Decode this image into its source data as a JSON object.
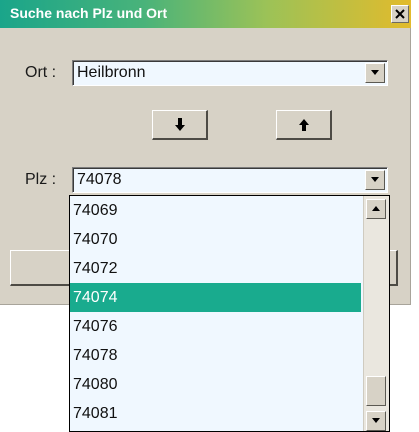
{
  "window": {
    "title": "Suche nach Plz und Ort"
  },
  "ort": {
    "label": "Ort :",
    "value": "Heilbronn"
  },
  "plz": {
    "label": "Plz :",
    "value": "74078"
  },
  "buttons": {
    "down_icon": "arrow-down-icon",
    "up_icon": "arrow-up-icon"
  },
  "dropdown": {
    "items": [
      "74069",
      "74070",
      "74072",
      "74074",
      "74076",
      "74078",
      "74080",
      "74081"
    ],
    "selected": "74074"
  },
  "colors": {
    "title_gradient_start": "#1aa58a",
    "title_gradient_end": "#e2bb2c",
    "selection": "#19ab8e",
    "field_background": "#f0f8ff"
  }
}
